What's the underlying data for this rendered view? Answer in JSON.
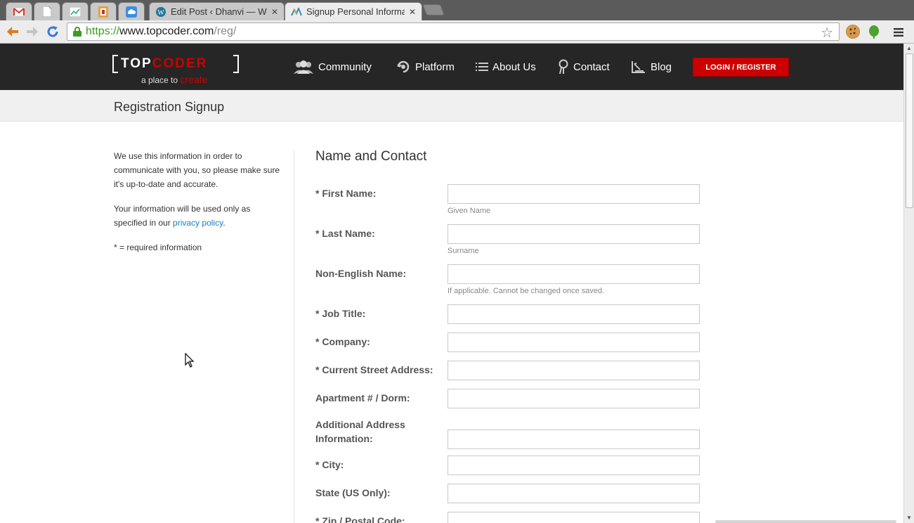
{
  "browser": {
    "tabs": [
      {
        "label": "",
        "icon": "gmail-icon"
      },
      {
        "label": "",
        "icon": "document-icon"
      },
      {
        "label": "",
        "icon": "chart-icon"
      },
      {
        "label": "",
        "icon": "bookmark-app-icon"
      },
      {
        "label": "",
        "icon": "cloud-icon"
      },
      {
        "label": "Edit Post ‹ Dhanvi — Wor",
        "icon": "wordpress-icon"
      },
      {
        "label": "Signup Personal Informati",
        "icon": "topcoder-icon"
      }
    ],
    "url": {
      "scheme": "https://",
      "host": "www.topcoder.com",
      "path": "/reg/"
    }
  },
  "site": {
    "logo": {
      "word_white": "TOP",
      "word_red": "CODER",
      "tag_white": "a place to ",
      "tag_red": "create"
    },
    "nav": [
      {
        "label": "Community",
        "icon": "community-icon"
      },
      {
        "label": "Platform",
        "icon": "platform-icon"
      },
      {
        "label": "About Us",
        "icon": "list-icon"
      },
      {
        "label": "Contact",
        "icon": "location-pin-icon"
      },
      {
        "label": "Blog",
        "icon": "blog-icon"
      }
    ],
    "login_label": "LOGIN / REGISTER"
  },
  "page": {
    "title": "Registration Signup",
    "sidebar": {
      "para1": "We use this information in order to communicate with you, so please make sure it's up-to-date and accurate.",
      "para2_before": "Your information will be used only as specified in our ",
      "para2_link": "privacy policy",
      "para2_after": ".",
      "para3": "* = required information"
    },
    "form": {
      "title": "Name and Contact",
      "fields": [
        {
          "label": "* First Name:",
          "value": "",
          "hint": "Given Name"
        },
        {
          "label": "* Last Name:",
          "value": "",
          "hint": "Surname"
        },
        {
          "label": "Non-English Name:",
          "value": "",
          "hint": "If applicable. Cannot be changed once saved."
        },
        {
          "label": "* Job Title:",
          "value": "",
          "hint": ""
        },
        {
          "label": "* Company:",
          "value": "",
          "hint": ""
        },
        {
          "label": "* Current Street Address:",
          "value": "",
          "hint": ""
        },
        {
          "label": "Apartment # / Dorm:",
          "value": "",
          "hint": ""
        },
        {
          "label": "Additional Address Information:",
          "value": "",
          "hint": ""
        },
        {
          "label": "* City:",
          "value": "",
          "hint": ""
        },
        {
          "label": "State (US Only):",
          "value": "",
          "hint": ""
        },
        {
          "label": "* Zip / Postal Code:",
          "value": "",
          "hint": ""
        }
      ]
    }
  },
  "colors": {
    "brand_red": "#cc0000",
    "header_bg": "#262626",
    "link": "#1a7fc1"
  }
}
